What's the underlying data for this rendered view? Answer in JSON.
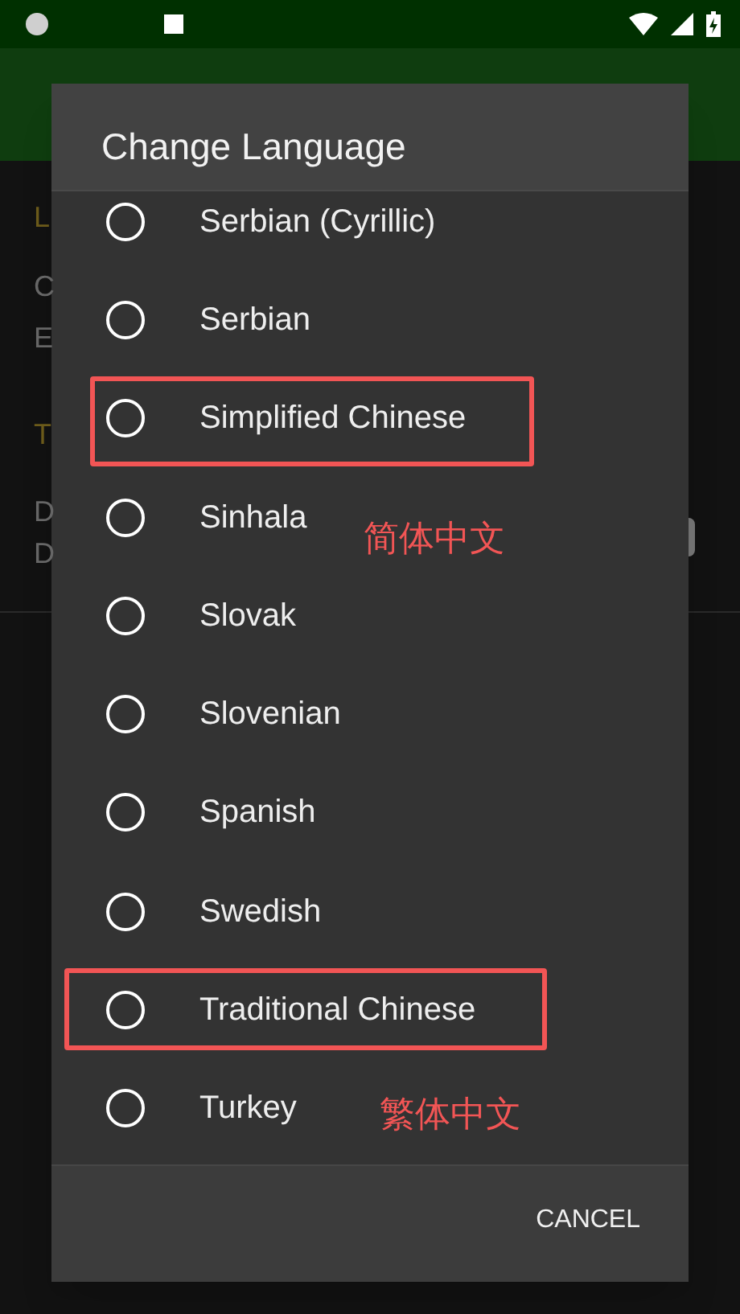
{
  "background": {
    "texts": [
      "L",
      "C",
      "E",
      "T",
      "D",
      "D"
    ]
  },
  "dialog": {
    "title": "Change Language",
    "options": [
      {
        "label": "Serbian (Cyrillic)",
        "selected": false
      },
      {
        "label": "Serbian",
        "selected": false
      },
      {
        "label": "Simplified Chinese",
        "selected": false
      },
      {
        "label": "Sinhala",
        "selected": false
      },
      {
        "label": "Slovak",
        "selected": false
      },
      {
        "label": "Slovenian",
        "selected": false
      },
      {
        "label": "Spanish",
        "selected": false
      },
      {
        "label": "Swedish",
        "selected": false
      },
      {
        "label": "Traditional Chinese",
        "selected": false
      },
      {
        "label": "Turkey",
        "selected": false
      }
    ],
    "buttons": [
      "CANCEL"
    ]
  },
  "annotations": [
    {
      "note": "简体中文"
    },
    {
      "note": "繁体中文"
    }
  ]
}
